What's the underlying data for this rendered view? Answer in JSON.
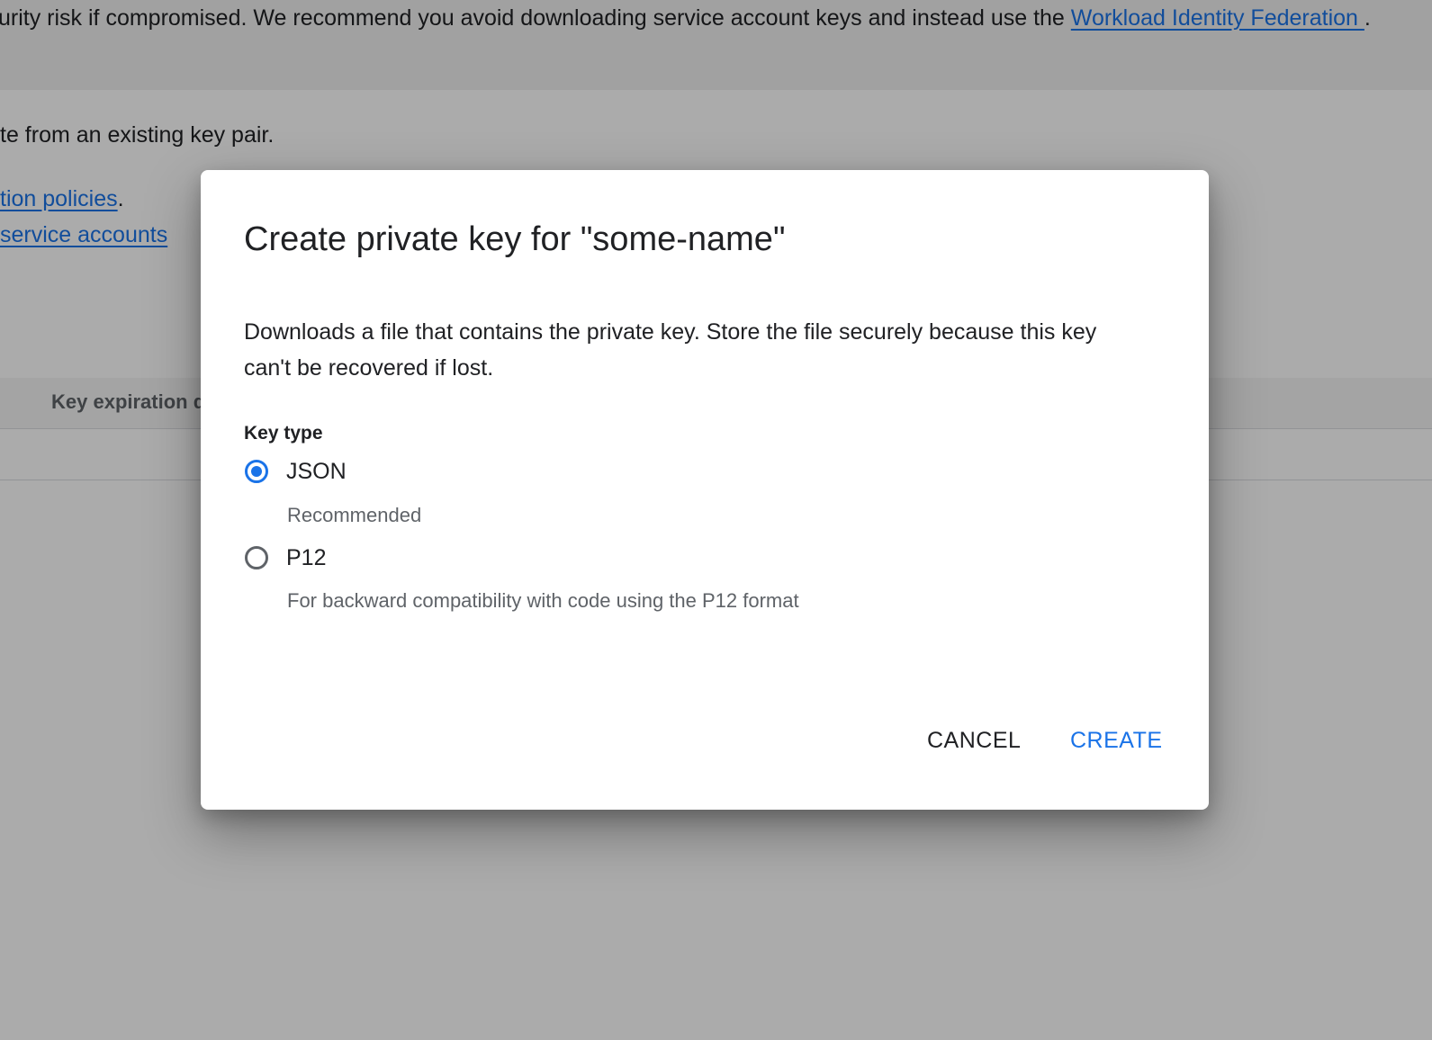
{
  "background": {
    "banner": {
      "text": "urity risk if compromised. We recommend you avoid downloading service account keys and instead use the ",
      "link": "Workload Identity Federation ",
      "suffix": "."
    },
    "line1": "te from an existing key pair.",
    "line2_link": "tion policies",
    "line2_suffix": ".",
    "line3_link": " service accounts",
    "table_header": "Key expiration d"
  },
  "dialog": {
    "title": "Create private key for \"some-name\"",
    "description": "Downloads a file that contains the private key. Store the file securely because this key can't be recovered if lost.",
    "key_type_label": "Key type",
    "options": [
      {
        "label": "JSON",
        "help": "Recommended",
        "selected": true
      },
      {
        "label": "P12",
        "help": "For backward compatibility with code using the P12 format",
        "selected": false
      }
    ],
    "cancel_label": "CANCEL",
    "create_label": "CREATE"
  },
  "colors": {
    "accent": "#1a73e8",
    "scrim": "rgba(0,0,0,0.33)"
  }
}
